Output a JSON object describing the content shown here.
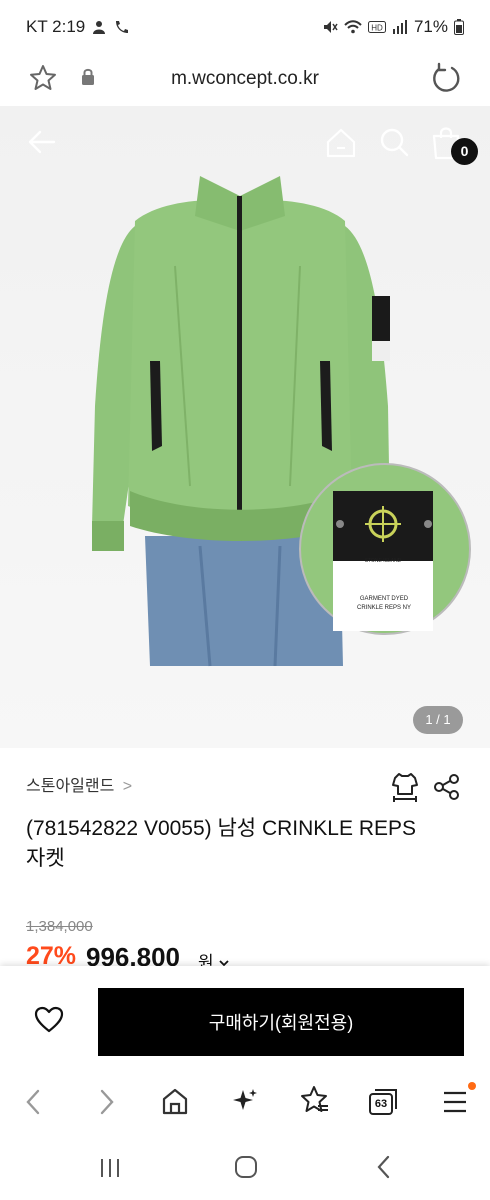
{
  "status_bar": {
    "carrier_time": "KT 2:19",
    "battery": "71%"
  },
  "url_bar": {
    "url": "m.wconcept.co.kr"
  },
  "hero": {
    "cart_count": "0",
    "page_indicator": "1 / 1",
    "tag_line1": "GARMENT DYED",
    "tag_line2": "CRINKLE REPS NY",
    "tag_brand": "STONE ISLAND"
  },
  "product": {
    "brand": "스톤아일랜드",
    "title": "(781542822 V0055) 남성 CRINKLE REPS 자켓",
    "price_original": "1,384,000",
    "discount": "27%",
    "price_final": "996,800",
    "price_unit": "원"
  },
  "purchase": {
    "buy_label": "구매하기(회원전용)"
  },
  "browser_toolbar": {
    "tab_count": "63"
  },
  "colors": {
    "accent_discount": "#ff4a1c",
    "jacket_green": "#8fc47a",
    "buy_button": "#000000",
    "notification_dot": "#ff6a13"
  }
}
